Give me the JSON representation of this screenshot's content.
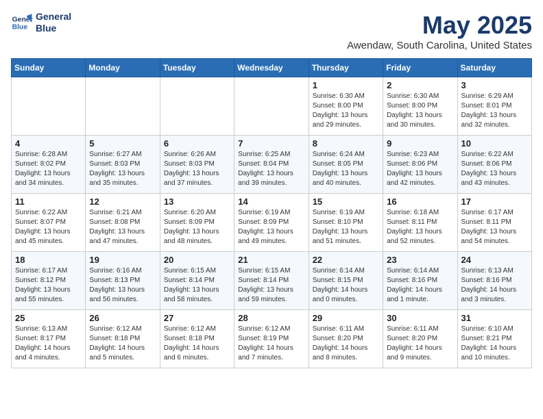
{
  "header": {
    "logo_line1": "General",
    "logo_line2": "Blue",
    "month": "May 2025",
    "location": "Awendaw, South Carolina, United States"
  },
  "weekdays": [
    "Sunday",
    "Monday",
    "Tuesday",
    "Wednesday",
    "Thursday",
    "Friday",
    "Saturday"
  ],
  "weeks": [
    [
      {
        "day": "",
        "info": ""
      },
      {
        "day": "",
        "info": ""
      },
      {
        "day": "",
        "info": ""
      },
      {
        "day": "",
        "info": ""
      },
      {
        "day": "1",
        "info": "Sunrise: 6:30 AM\nSunset: 8:00 PM\nDaylight: 13 hours\nand 29 minutes."
      },
      {
        "day": "2",
        "info": "Sunrise: 6:30 AM\nSunset: 8:00 PM\nDaylight: 13 hours\nand 30 minutes."
      },
      {
        "day": "3",
        "info": "Sunrise: 6:29 AM\nSunset: 8:01 PM\nDaylight: 13 hours\nand 32 minutes."
      }
    ],
    [
      {
        "day": "4",
        "info": "Sunrise: 6:28 AM\nSunset: 8:02 PM\nDaylight: 13 hours\nand 34 minutes."
      },
      {
        "day": "5",
        "info": "Sunrise: 6:27 AM\nSunset: 8:03 PM\nDaylight: 13 hours\nand 35 minutes."
      },
      {
        "day": "6",
        "info": "Sunrise: 6:26 AM\nSunset: 8:03 PM\nDaylight: 13 hours\nand 37 minutes."
      },
      {
        "day": "7",
        "info": "Sunrise: 6:25 AM\nSunset: 8:04 PM\nDaylight: 13 hours\nand 39 minutes."
      },
      {
        "day": "8",
        "info": "Sunrise: 6:24 AM\nSunset: 8:05 PM\nDaylight: 13 hours\nand 40 minutes."
      },
      {
        "day": "9",
        "info": "Sunrise: 6:23 AM\nSunset: 8:06 PM\nDaylight: 13 hours\nand 42 minutes."
      },
      {
        "day": "10",
        "info": "Sunrise: 6:22 AM\nSunset: 8:06 PM\nDaylight: 13 hours\nand 43 minutes."
      }
    ],
    [
      {
        "day": "11",
        "info": "Sunrise: 6:22 AM\nSunset: 8:07 PM\nDaylight: 13 hours\nand 45 minutes."
      },
      {
        "day": "12",
        "info": "Sunrise: 6:21 AM\nSunset: 8:08 PM\nDaylight: 13 hours\nand 47 minutes."
      },
      {
        "day": "13",
        "info": "Sunrise: 6:20 AM\nSunset: 8:09 PM\nDaylight: 13 hours\nand 48 minutes."
      },
      {
        "day": "14",
        "info": "Sunrise: 6:19 AM\nSunset: 8:09 PM\nDaylight: 13 hours\nand 49 minutes."
      },
      {
        "day": "15",
        "info": "Sunrise: 6:19 AM\nSunset: 8:10 PM\nDaylight: 13 hours\nand 51 minutes."
      },
      {
        "day": "16",
        "info": "Sunrise: 6:18 AM\nSunset: 8:11 PM\nDaylight: 13 hours\nand 52 minutes."
      },
      {
        "day": "17",
        "info": "Sunrise: 6:17 AM\nSunset: 8:11 PM\nDaylight: 13 hours\nand 54 minutes."
      }
    ],
    [
      {
        "day": "18",
        "info": "Sunrise: 6:17 AM\nSunset: 8:12 PM\nDaylight: 13 hours\nand 55 minutes."
      },
      {
        "day": "19",
        "info": "Sunrise: 6:16 AM\nSunset: 8:13 PM\nDaylight: 13 hours\nand 56 minutes."
      },
      {
        "day": "20",
        "info": "Sunrise: 6:15 AM\nSunset: 8:14 PM\nDaylight: 13 hours\nand 58 minutes."
      },
      {
        "day": "21",
        "info": "Sunrise: 6:15 AM\nSunset: 8:14 PM\nDaylight: 13 hours\nand 59 minutes."
      },
      {
        "day": "22",
        "info": "Sunrise: 6:14 AM\nSunset: 8:15 PM\nDaylight: 14 hours\nand 0 minutes."
      },
      {
        "day": "23",
        "info": "Sunrise: 6:14 AM\nSunset: 8:16 PM\nDaylight: 14 hours\nand 1 minute."
      },
      {
        "day": "24",
        "info": "Sunrise: 6:13 AM\nSunset: 8:16 PM\nDaylight: 14 hours\nand 3 minutes."
      }
    ],
    [
      {
        "day": "25",
        "info": "Sunrise: 6:13 AM\nSunset: 8:17 PM\nDaylight: 14 hours\nand 4 minutes."
      },
      {
        "day": "26",
        "info": "Sunrise: 6:12 AM\nSunset: 8:18 PM\nDaylight: 14 hours\nand 5 minutes."
      },
      {
        "day": "27",
        "info": "Sunrise: 6:12 AM\nSunset: 8:18 PM\nDaylight: 14 hours\nand 6 minutes."
      },
      {
        "day": "28",
        "info": "Sunrise: 6:12 AM\nSunset: 8:19 PM\nDaylight: 14 hours\nand 7 minutes."
      },
      {
        "day": "29",
        "info": "Sunrise: 6:11 AM\nSunset: 8:20 PM\nDaylight: 14 hours\nand 8 minutes."
      },
      {
        "day": "30",
        "info": "Sunrise: 6:11 AM\nSunset: 8:20 PM\nDaylight: 14 hours\nand 9 minutes."
      },
      {
        "day": "31",
        "info": "Sunrise: 6:10 AM\nSunset: 8:21 PM\nDaylight: 14 hours\nand 10 minutes."
      }
    ]
  ]
}
